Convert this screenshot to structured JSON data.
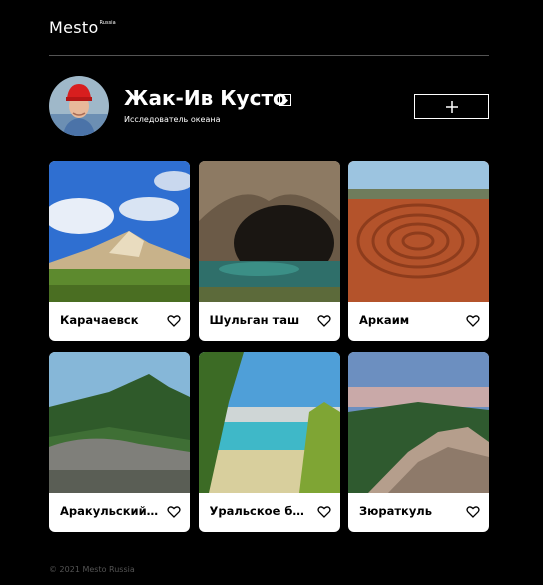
{
  "header": {
    "logo_main": "Mesto",
    "logo_sub": "Russia"
  },
  "profile": {
    "name": "Жак-Ив Кусто",
    "about": "Исследователь океана",
    "add_label": "+"
  },
  "cards": [
    {
      "title": "Карачаевск",
      "icon": "heart-icon"
    },
    {
      "title": "Шульган таш",
      "icon": "heart-icon"
    },
    {
      "title": "Аркаим",
      "icon": "heart-icon"
    },
    {
      "title": "Аракульский ...",
      "icon": "heart-icon"
    },
    {
      "title": "Уральское ба...",
      "icon": "heart-icon"
    },
    {
      "title": "Зюраткуль",
      "icon": "heart-icon"
    }
  ],
  "footer": {
    "copyright": "© 2021 Mesto Russia"
  },
  "colors": {
    "background": "#000000",
    "card": "#ffffff",
    "divider": "#545454",
    "footer_text": "#545454"
  }
}
